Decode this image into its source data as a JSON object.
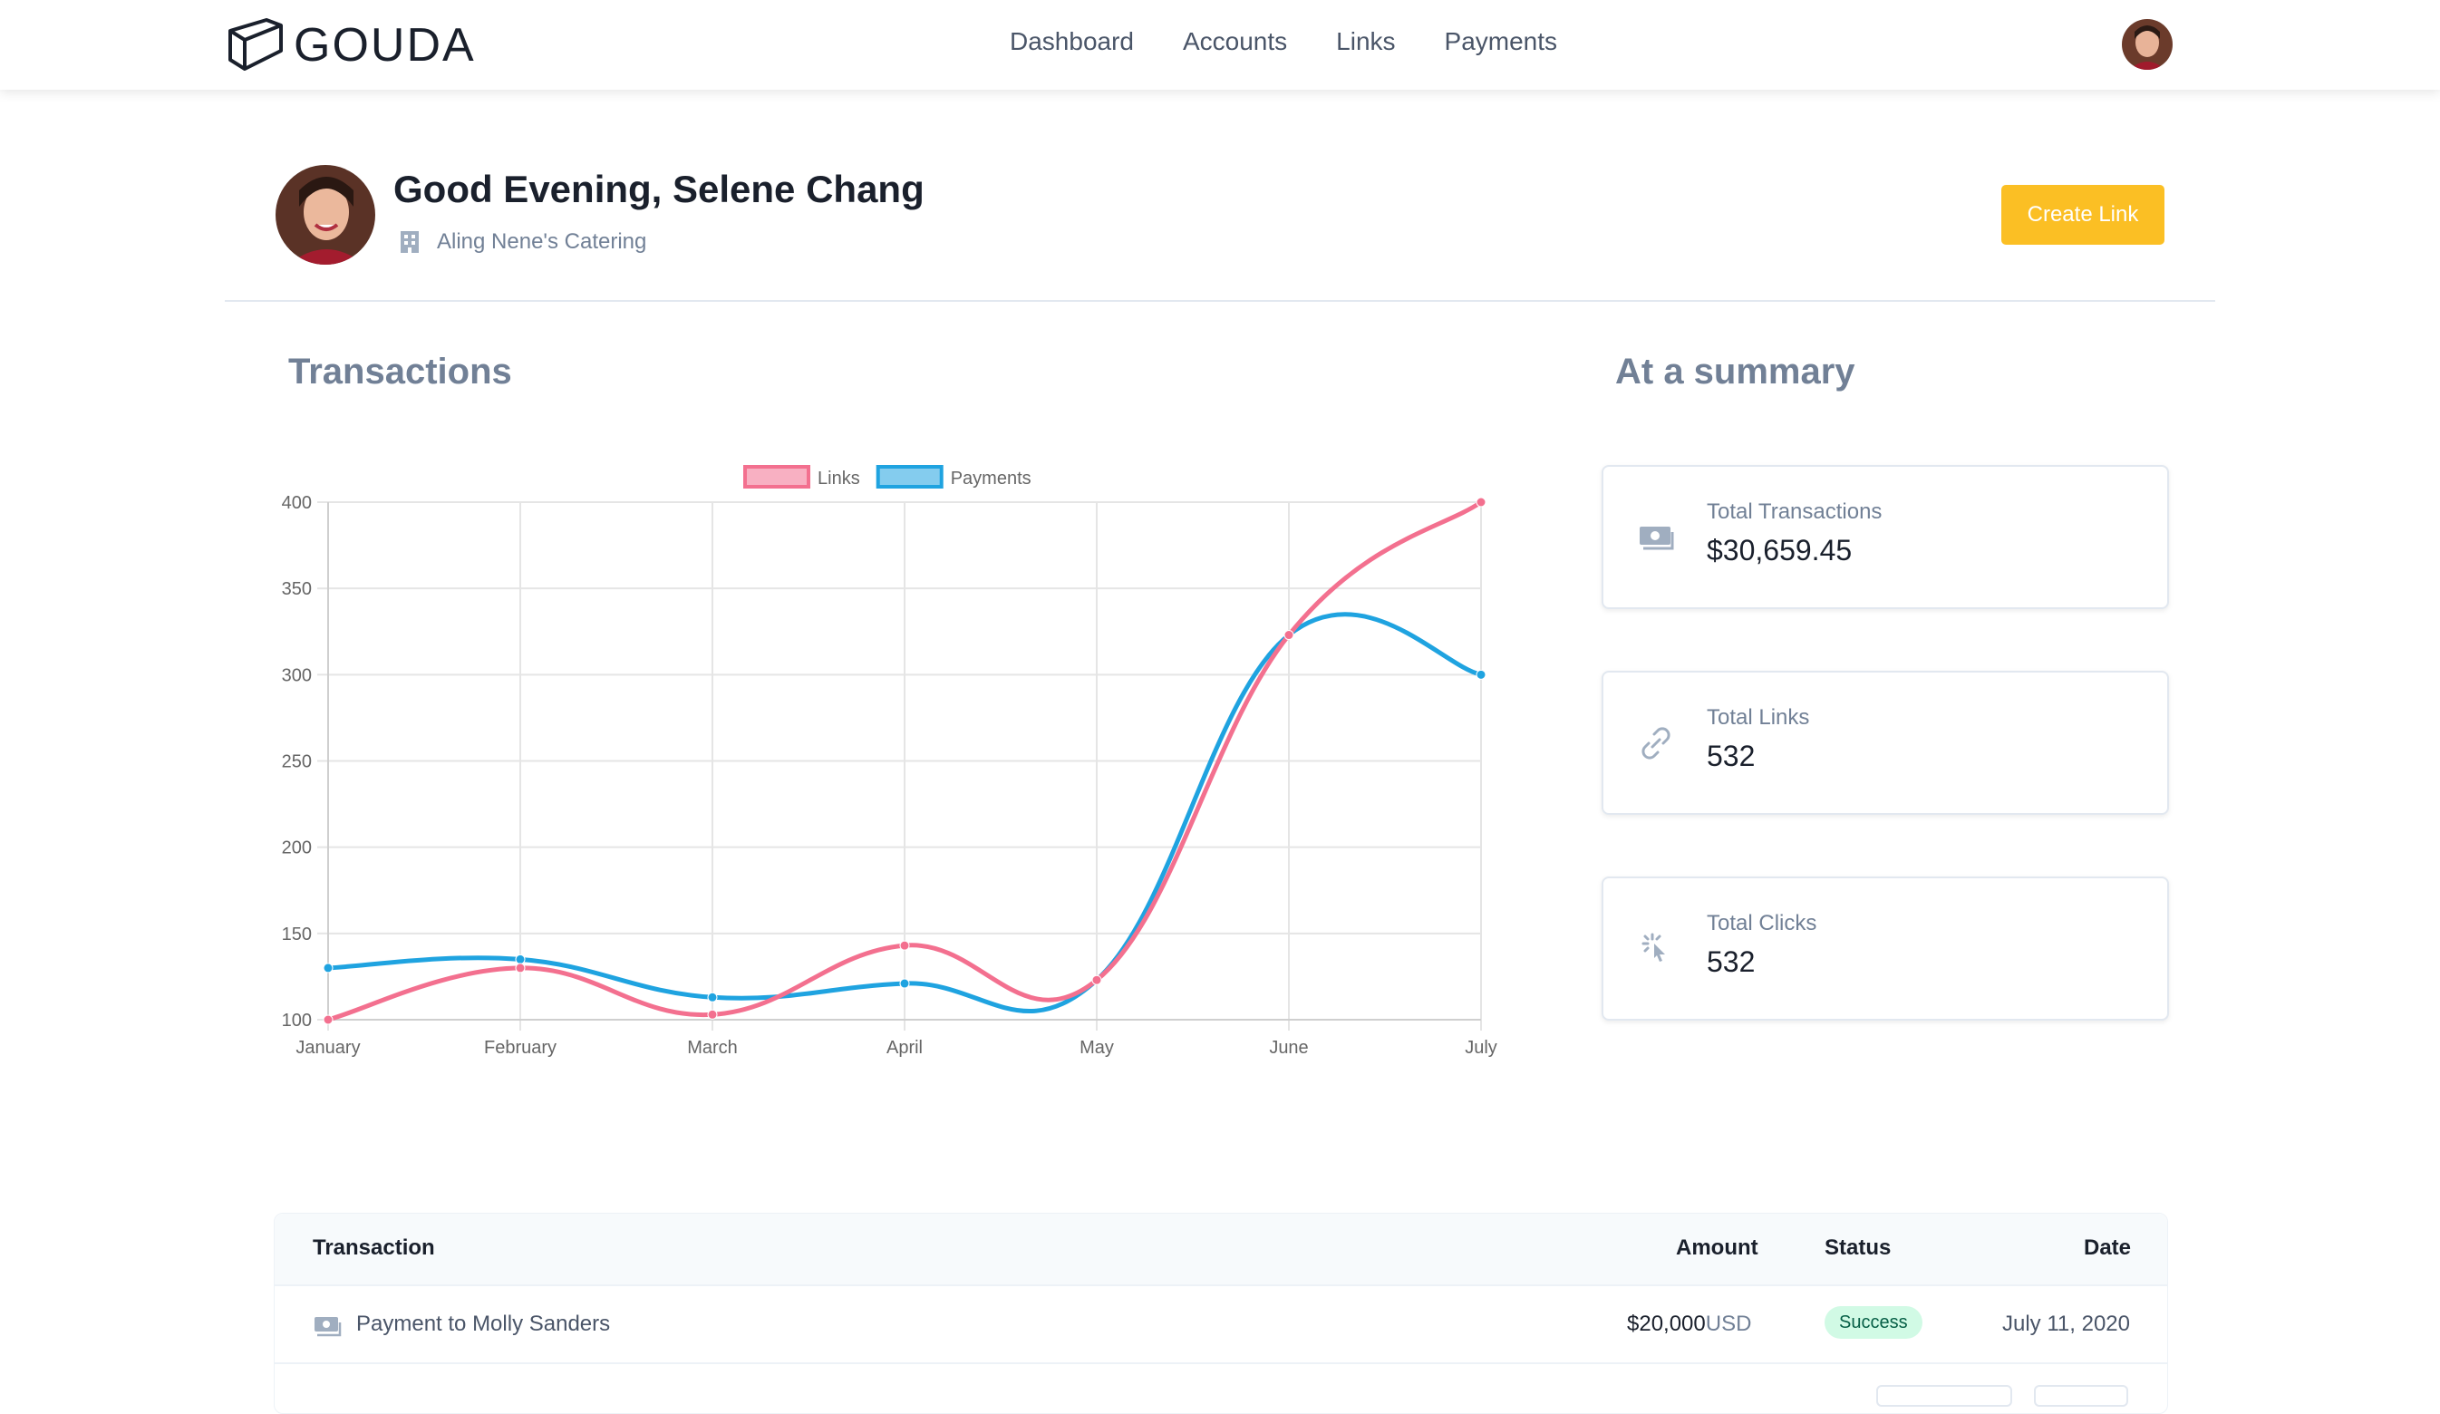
{
  "brand": {
    "name": "GOUDA"
  },
  "nav": {
    "items": [
      "Dashboard",
      "Accounts",
      "Links",
      "Payments"
    ]
  },
  "header": {
    "greeting": "Good Evening, Selene Chang",
    "company": "Aling Nene's Catering",
    "create_button": "Create Link"
  },
  "transactions": {
    "title": "Transactions"
  },
  "summary": {
    "title": "At a summary",
    "cards": [
      {
        "label": "Total Transactions",
        "value": "$30,659.45",
        "icon": "money-icon"
      },
      {
        "label": "Total Links",
        "value": "532",
        "icon": "link-icon"
      },
      {
        "label": "Total Clicks",
        "value": "532",
        "icon": "click-icon"
      }
    ]
  },
  "table": {
    "headers": {
      "transaction": "Transaction",
      "amount": "Amount",
      "status": "Status",
      "date": "Date"
    },
    "rows": [
      {
        "name": "Payment to Molly Sanders",
        "amount": "$20,000",
        "currency": "USD",
        "status": "Success",
        "date": "July 11, 2020"
      }
    ]
  },
  "colors": {
    "accent": "#fbbf24",
    "links": "#f3708f",
    "payments": "#1fa3e0",
    "success_bg": "#d1fae5"
  },
  "chart_data": {
    "type": "line",
    "title": "",
    "xlabel": "",
    "ylabel": "",
    "categories": [
      "January",
      "February",
      "March",
      "April",
      "May",
      "June",
      "July"
    ],
    "series": [
      {
        "name": "Links",
        "values": [
          100,
          130,
          103,
          143,
          123,
          323,
          400
        ],
        "color": "#f3708f"
      },
      {
        "name": "Payments",
        "values": [
          130,
          135,
          113,
          121,
          123,
          323,
          300
        ],
        "color": "#1fa3e0"
      }
    ],
    "ylim": [
      100,
      400
    ],
    "yticks": [
      100,
      150,
      200,
      250,
      300,
      350,
      400
    ],
    "grid": true,
    "legend": "top-center"
  }
}
